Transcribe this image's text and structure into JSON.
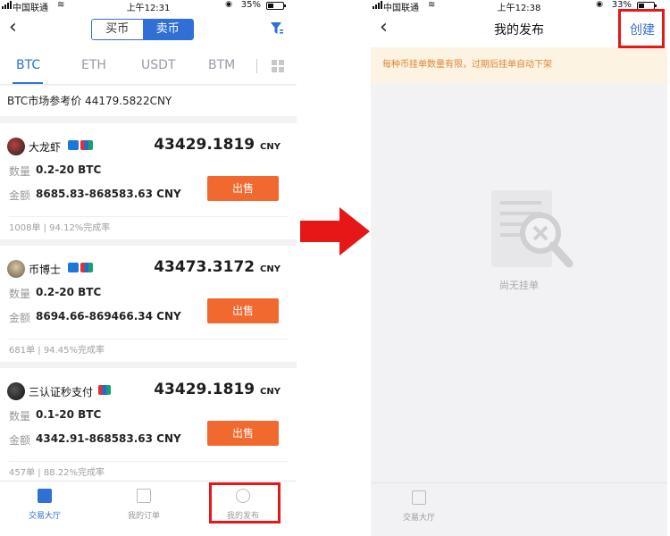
{
  "left": {
    "status": {
      "carrier": "中国联通",
      "time": "上午12:31",
      "battery": "35%",
      "battery_level": 0.35
    },
    "nav": {
      "back": "‹",
      "buy_tab": "买币",
      "sell_tab": "卖币",
      "filter_icon": "filter-icon"
    },
    "coin_tabs": [
      "BTC",
      "ETH",
      "USDT",
      "BTM"
    ],
    "ref_price": "BTC市场参考价 44179.5822CNY",
    "listings": [
      {
        "name": "大龙虾",
        "price": "43429.1819",
        "currency": "CNY",
        "qty_label": "数量",
        "qty": "0.2-20 BTC",
        "amt_label": "金额",
        "amt": "8685.83-868583.63 CNY",
        "action": "出售",
        "stats": "1008单 | 94.12%完成率"
      },
      {
        "name": "币博士",
        "price": "43473.3172",
        "currency": "CNY",
        "qty_label": "数量",
        "qty": "0.2-20 BTC",
        "amt_label": "金额",
        "amt": "8694.66-869466.34 CNY",
        "action": "出售",
        "stats": "681单 | 94.45%完成率"
      },
      {
        "name": "三认证秒支付",
        "price": "43429.1819",
        "currency": "CNY",
        "qty_label": "数量",
        "qty": "0.1-20 BTC",
        "amt_label": "金额",
        "amt": "4342.91-868583.63 CNY",
        "action": "出售",
        "stats": "457单 | 88.22%完成率"
      }
    ],
    "bottom_nav": [
      "交易大厅",
      "我的订单",
      "我的发布"
    ]
  },
  "right": {
    "status": {
      "carrier": "中国联通",
      "time": "上午12:38",
      "battery": "33%",
      "battery_level": 0.33
    },
    "nav": {
      "back": "‹",
      "title": "我的发布",
      "create": "创建"
    },
    "notice": "每种币挂单数量有限，过期后挂单自动下架",
    "empty_text": "尚无挂单",
    "bottom_nav": [
      "交易大厅"
    ]
  },
  "colors": {
    "accent": "#2f6fd6",
    "sell_button": "#f2692f",
    "highlight_box": "#e51717",
    "arrow": "#e51717",
    "notice_bg": "#fdf3e3",
    "notice_text": "#e0853a"
  }
}
